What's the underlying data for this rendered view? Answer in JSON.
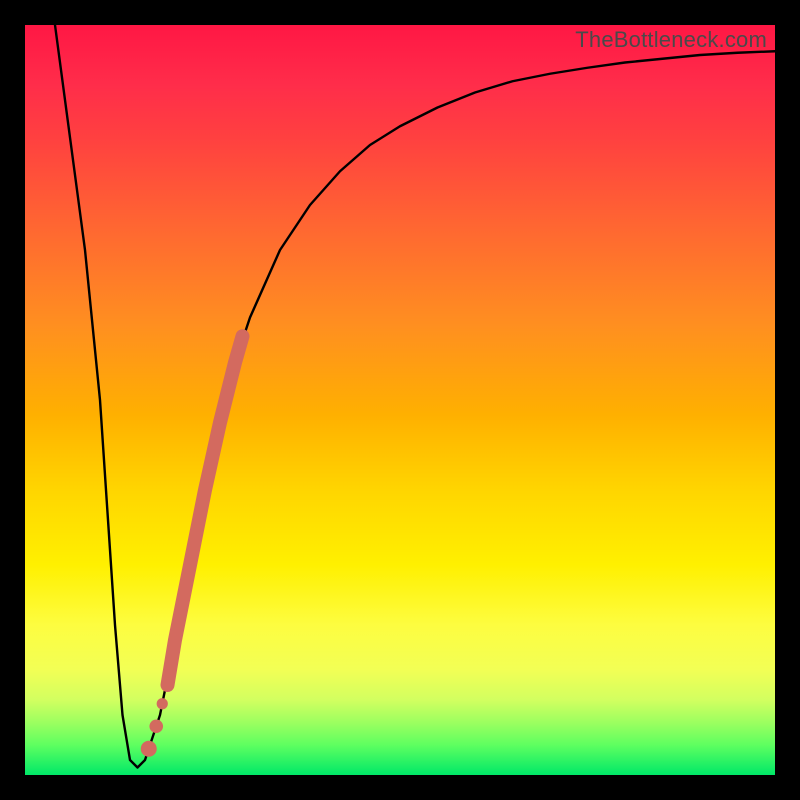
{
  "watermark": "TheBottleneck.com",
  "colors": {
    "bg": "#000000",
    "curve": "#000000",
    "accent": "#d36a5f",
    "gradient_top": "#ff1744",
    "gradient_mid": "#ffd500",
    "gradient_bottom": "#00e868"
  },
  "chart_data": {
    "type": "line",
    "title": "",
    "xlabel": "",
    "ylabel": "",
    "xlim": [
      0,
      100
    ],
    "ylim": [
      0,
      100
    ],
    "grid": false,
    "legend": false,
    "series": [
      {
        "name": "bottleneck-curve",
        "x": [
          4,
          6,
          8,
          10,
          11,
          12,
          13,
          14,
          15,
          16,
          18,
          20,
          22,
          24,
          26,
          28,
          30,
          34,
          38,
          42,
          46,
          50,
          55,
          60,
          65,
          70,
          75,
          80,
          85,
          90,
          95,
          100
        ],
        "y": [
          100,
          85,
          70,
          50,
          35,
          20,
          8,
          2,
          1,
          2,
          8,
          18,
          28,
          38,
          47,
          55,
          61,
          70,
          76,
          80.5,
          84,
          86.5,
          89,
          91,
          92.5,
          93.5,
          94.3,
          95,
          95.5,
          96,
          96.3,
          96.5
        ]
      }
    ],
    "accent_segment": {
      "name": "highlight-band",
      "x": [
        19,
        20,
        21,
        22,
        23,
        24,
        25,
        26,
        27,
        28,
        29
      ],
      "y": [
        12,
        18,
        23,
        28,
        33,
        38,
        42.5,
        47,
        51,
        55,
        58.5
      ]
    },
    "accent_dots": {
      "name": "highlight-dots",
      "points": [
        {
          "x": 16.5,
          "y": 3.5
        },
        {
          "x": 17.5,
          "y": 6.5
        },
        {
          "x": 18.3,
          "y": 9.5
        }
      ]
    }
  }
}
